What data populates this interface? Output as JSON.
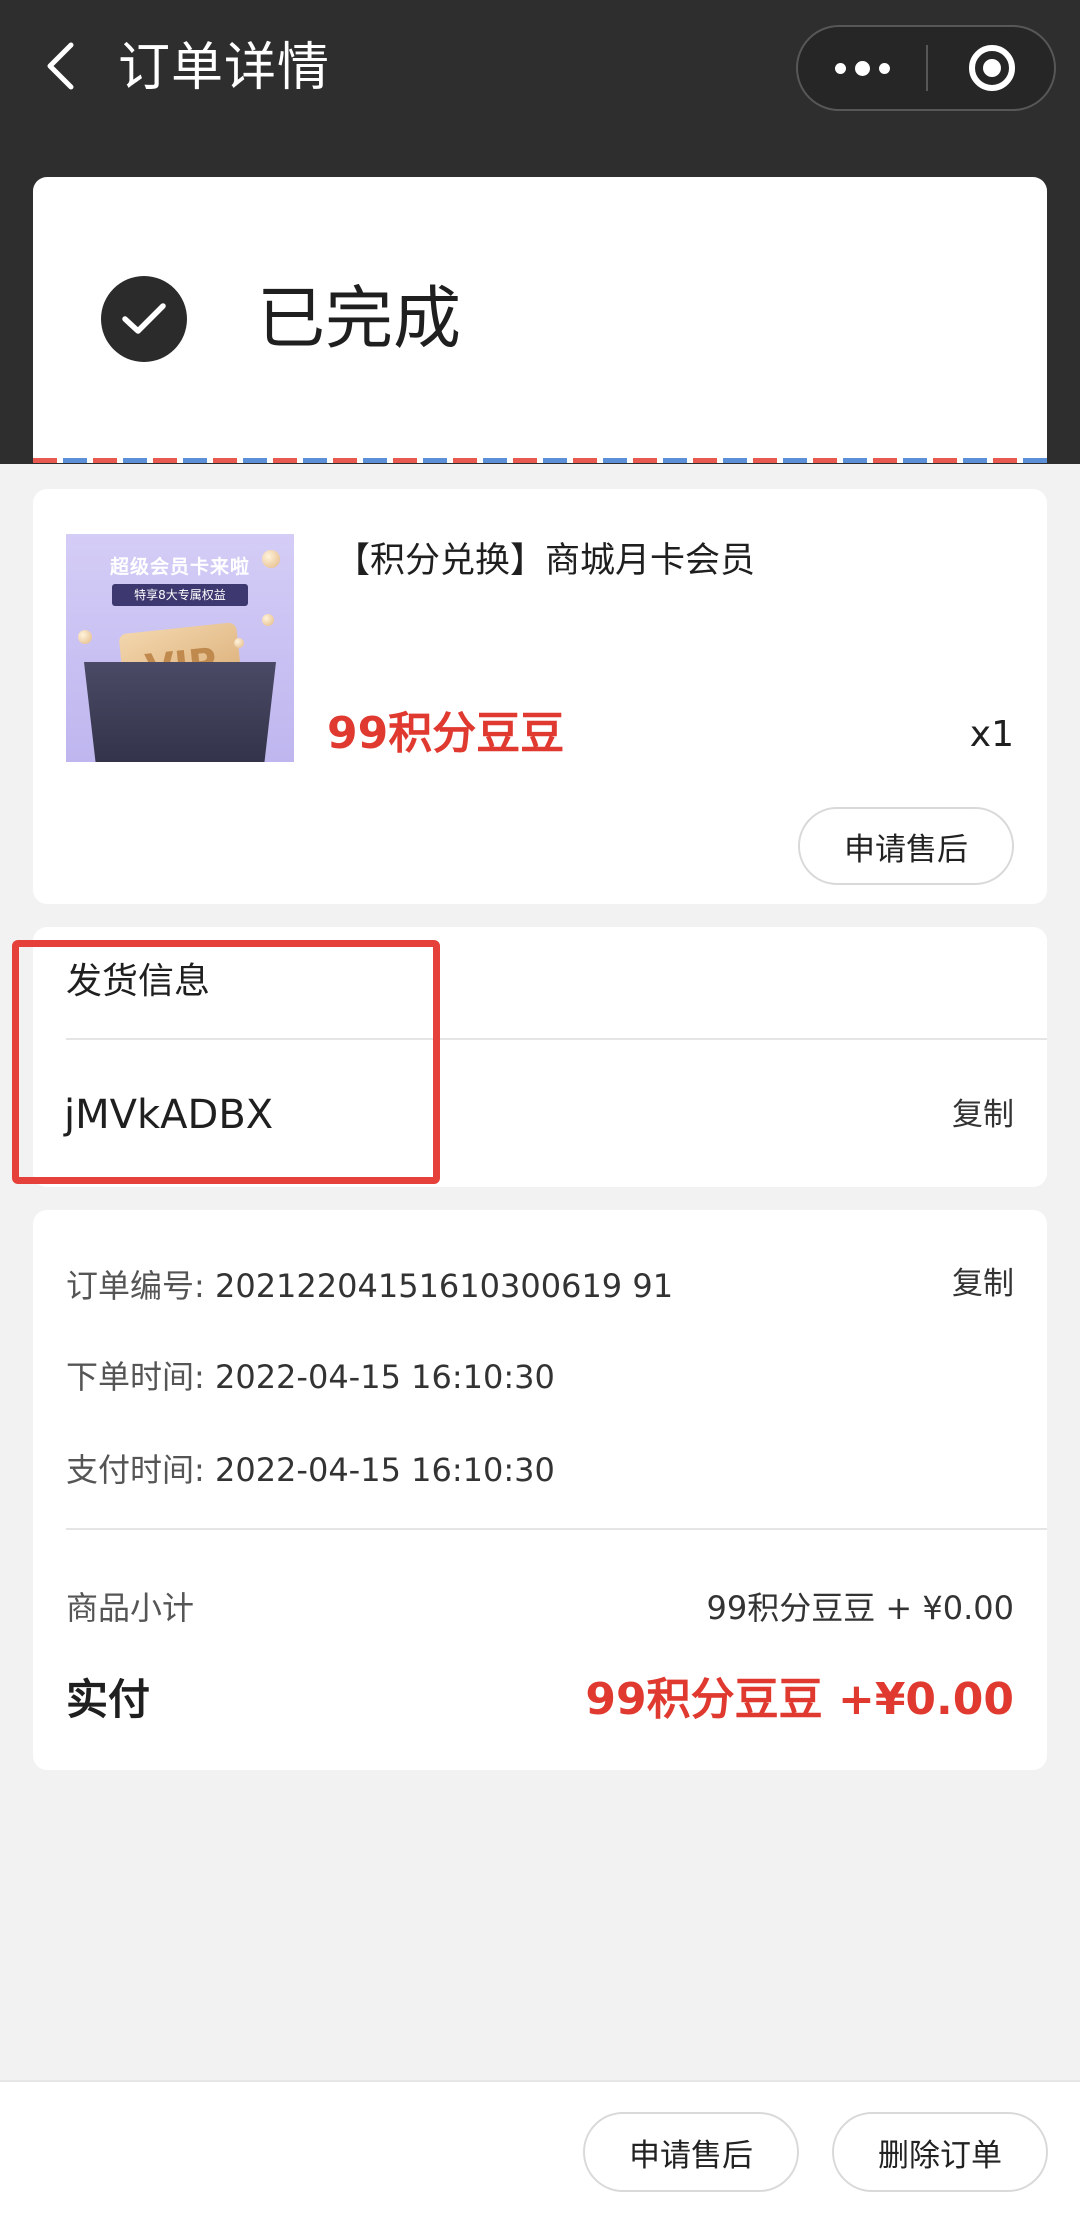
{
  "nav": {
    "title": "订单详情",
    "back_icon": "chevron-left-icon",
    "more_icon": "more-dots-icon",
    "close_icon": "target-circle-icon"
  },
  "status": {
    "text": "已完成",
    "icon": "check-circle-icon"
  },
  "product": {
    "image_title": "超级会员卡来啦",
    "image_subtitle": "特享8大专属权益",
    "image_badge": "VIP",
    "name": "【积分兑换】商城月卡会员",
    "price": "99积分豆豆",
    "quantity": "x1",
    "after_sale_label": "申请售后"
  },
  "shipping": {
    "title": "发货信息",
    "code": "jMVkADBX",
    "copy_label": "复制"
  },
  "order": {
    "number_label": "订单编号:",
    "number_value": "20212204151610300619 91",
    "copy_label": "复制",
    "created_label": "下单时间:",
    "created_value": "2022-04-15 16:10:30",
    "paid_time_label": "支付时间:",
    "paid_time_value": "2022-04-15 16:10:30",
    "subtotal_label": "商品小计",
    "subtotal_value": "99积分豆豆 + ¥0.00",
    "paid_label": "实付",
    "paid_value": "99积分豆豆 +¥0.00"
  },
  "bottom": {
    "after_sale_label": "申请售后",
    "delete_label": "删除订单"
  },
  "colors": {
    "header_bg": "#2e2e2e",
    "accent_red": "#e0392f",
    "highlight_border": "#e5413a"
  }
}
